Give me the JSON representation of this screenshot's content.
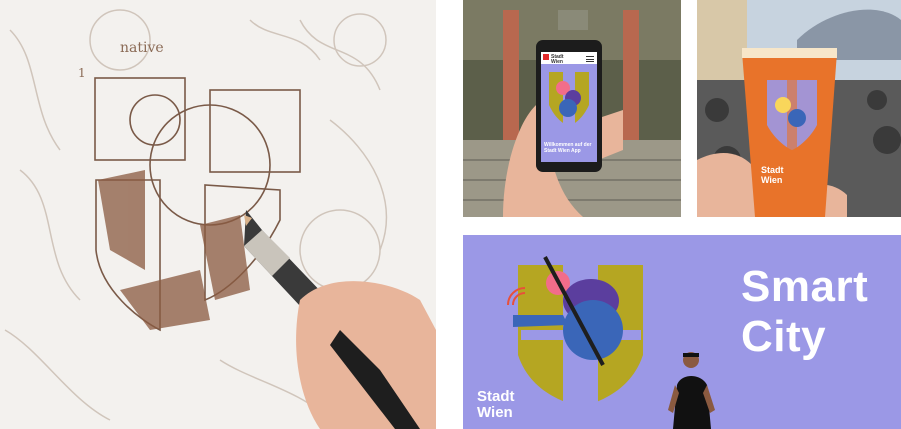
{
  "sketch": {
    "word": "native",
    "step_number": "1",
    "colors": {
      "paper": "#f3f1ee",
      "pencil": "#8a6a55"
    }
  },
  "phone_photo": {
    "app_logo": [
      "Stadt",
      "Wien"
    ],
    "welcome_text": "Willkommen auf der Stadt Wien App",
    "colors": {
      "screen": "#9b98e6",
      "shield": "#b5a622"
    }
  },
  "cup_photo": {
    "cup_logo": [
      "Stadt",
      "Wien"
    ],
    "colors": {
      "beer": "#e8732a",
      "sky": "#d9e4ee"
    }
  },
  "banner": {
    "title_line1": "Smart",
    "title_line2": "City",
    "logo_line1": "Stadt",
    "logo_line2": "Wien",
    "colors": {
      "background": "#9b98e6",
      "shield": "#b5a622",
      "pink": "#f26d8a",
      "blue": "#3a66b8",
      "purple": "#5b3e9e"
    }
  }
}
